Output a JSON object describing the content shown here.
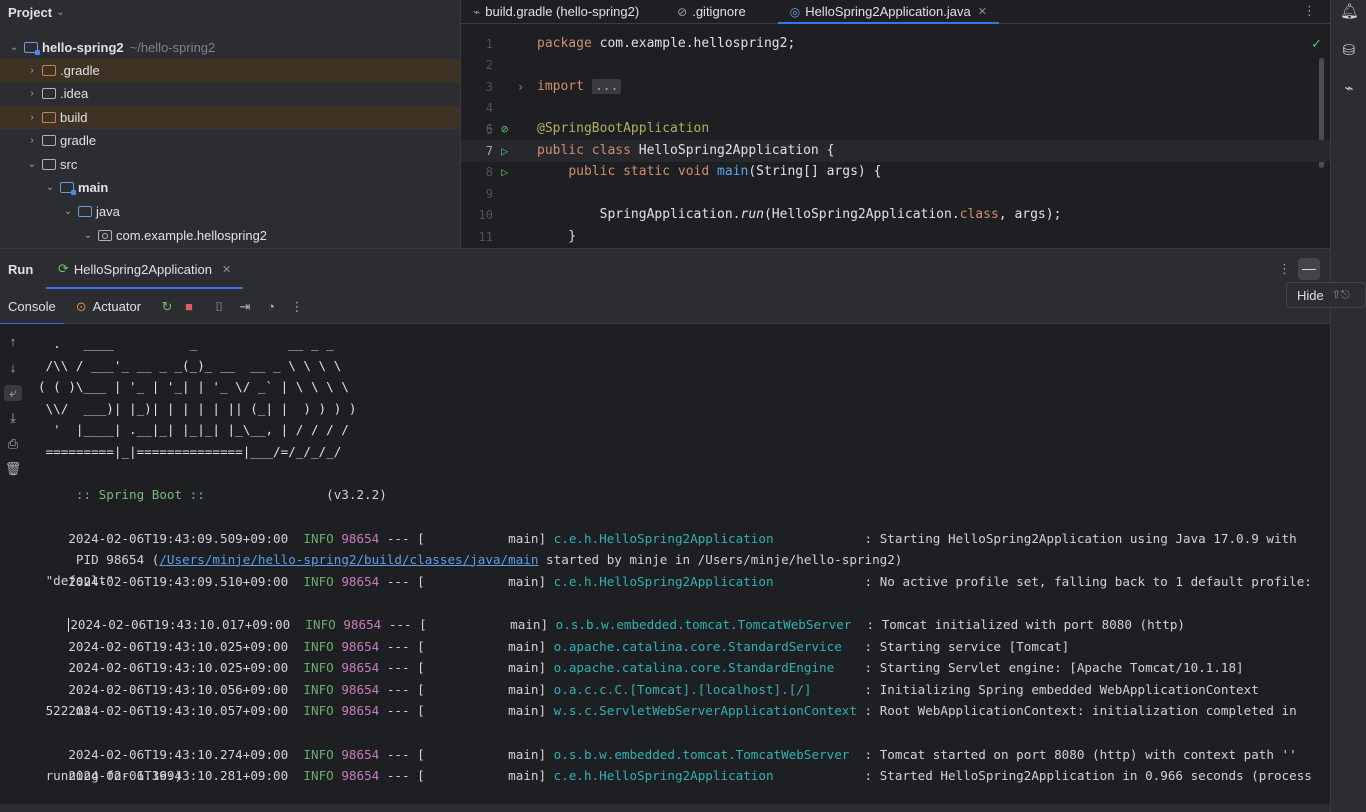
{
  "project": {
    "title": "Project",
    "tree": [
      {
        "name": "hello-spring2",
        "path": "~/hello-spring2",
        "level": 0,
        "expanded": true,
        "icon": "module-folder-icon",
        "bold": true
      },
      {
        "name": ".gradle",
        "level": 1,
        "expanded": false,
        "icon": "folder-icon",
        "excluded": true
      },
      {
        "name": ".idea",
        "level": 1,
        "expanded": false,
        "icon": "folder-icon"
      },
      {
        "name": "build",
        "level": 1,
        "expanded": false,
        "icon": "folder-icon",
        "excluded": true
      },
      {
        "name": "gradle",
        "level": 1,
        "expanded": false,
        "icon": "folder-icon"
      },
      {
        "name": "src",
        "level": 1,
        "expanded": true,
        "icon": "folder-icon"
      },
      {
        "name": "main",
        "level": 2,
        "expanded": true,
        "icon": "module-folder-icon",
        "bold": true
      },
      {
        "name": "java",
        "level": 3,
        "expanded": true,
        "icon": "source-folder-icon"
      },
      {
        "name": "com.example.hellospring2",
        "level": 4,
        "expanded": true,
        "icon": "package-icon"
      }
    ]
  },
  "editor": {
    "tabs": [
      {
        "label": "build.gradle (hello-spring2)",
        "icon": "gradle-icon",
        "active": false
      },
      {
        "label": ".gitignore",
        "icon": "ignore-file-icon",
        "active": false
      },
      {
        "label": "HelloSpring2Application.java",
        "icon": "spring-class-icon",
        "active": true
      }
    ],
    "line_numbers": [
      "1",
      "2",
      "3",
      "4",
      "5",
      "6",
      "7",
      "8",
      "9",
      "10",
      "11"
    ],
    "code": {
      "l1_kw": "package",
      "l1_rest": " com.example.hellospring2;",
      "l3_kw": "import",
      "l3_fold": "...",
      "l6_ann": "@SpringBootApplication",
      "l7_kw": "public class",
      "l7_rest": " HelloSpring2Application {",
      "l8_indent": "    ",
      "l8_kw": "public static void",
      "l8_fn": "main",
      "l8_rest": "(String[] args) {",
      "l10_a": "        SpringApplication.",
      "l10_it": "run",
      "l10_b": "(HelloSpring2Application.",
      "l10_kw": "class",
      "l10_c": ", args);",
      "l11": "    }"
    }
  },
  "run": {
    "title": "Run",
    "tab_label": "HelloSpring2Application",
    "hide_tooltip": "Hide",
    "hide_shortcut": "⇧⎋",
    "console_tab": "Console",
    "actuator_tab": "Actuator"
  },
  "console": {
    "banner": [
      "  .   ____          _            __ _ _",
      " /\\\\ / ___'_ __ _ _(_)_ __  __ _ \\ \\ \\ \\",
      "( ( )\\___ | '_ | '_| | '_ \\/ _` | \\ \\ \\ \\",
      " \\\\/  ___)| |_)| | | | | || (_| |  ) ) ) )",
      "  '  |____| .__|_| |_|_| |_\\__, | / / / /",
      " =========|_|==============|___/=/_/_/_/"
    ],
    "spring_label": " :: Spring Boot ::",
    "spring_version": "                (v3.2.2)",
    "logs": [
      {
        "ts": "2024-02-06T19:43:09.509+09:00",
        "level": "INFO",
        "pid": "98654",
        "thread": " --- [           main] ",
        "logger": "c.e.h.HelloSpring2Application           ",
        "msg": " : Starting HelloSpring2Application using Java 17.0.9 with"
      },
      {
        "ts": "2024-02-06T19:43:09.510+09:00",
        "level": "INFO",
        "pid": "98654",
        "thread": " --- [           main] ",
        "logger": "c.e.h.HelloSpring2Application           ",
        "msg": " : No active profile set, falling back to 1 default profile:"
      },
      {
        "ts": "2024-02-06T19:43:10.017+09:00",
        "level": "INFO",
        "pid": "98654",
        "thread": " --- [           main] ",
        "logger": "o.s.b.w.embedded.tomcat.TomcatWebServer ",
        "msg": " : Tomcat initialized with port 8080 (http)"
      },
      {
        "ts": "2024-02-06T19:43:10.025+09:00",
        "level": "INFO",
        "pid": "98654",
        "thread": " --- [           main] ",
        "logger": "o.apache.catalina.core.StandardService  ",
        "msg": " : Starting service [Tomcat]"
      },
      {
        "ts": "2024-02-06T19:43:10.025+09:00",
        "level": "INFO",
        "pid": "98654",
        "thread": " --- [           main] ",
        "logger": "o.apache.catalina.core.StandardEngine   ",
        "msg": " : Starting Servlet engine: [Apache Tomcat/10.1.18]"
      },
      {
        "ts": "2024-02-06T19:43:10.056+09:00",
        "level": "INFO",
        "pid": "98654",
        "thread": " --- [           main] ",
        "logger": "o.a.c.c.C.[Tomcat].[localhost].[/]      ",
        "msg": " : Initializing Spring embedded WebApplicationContext"
      },
      {
        "ts": "2024-02-06T19:43:10.057+09:00",
        "level": "INFO",
        "pid": "98654",
        "thread": " --- [           main] ",
        "logger": "w.s.c.ServletWebServerApplicationContext",
        "msg": " : Root WebApplicationContext: initialization completed in"
      },
      {
        "ts": "2024-02-06T19:43:10.274+09:00",
        "level": "INFO",
        "pid": "98654",
        "thread": " --- [           main] ",
        "logger": "o.s.b.w.embedded.tomcat.TomcatWebServer ",
        "msg": " : Tomcat started on port 8080 (http) with context path ''"
      },
      {
        "ts": "2024-02-06T19:43:10.281+09:00",
        "level": "INFO",
        "pid": "98654",
        "thread": " --- [           main] ",
        "logger": "c.e.h.HelloSpring2Application           ",
        "msg": " : Started HelloSpring2Application in 0.966 seconds (process"
      }
    ],
    "cont1_a": " PID 98654 (",
    "cont1_link": "/Users/minje/hello-spring2/build/classes/java/main",
    "cont1_b": " started by minje in /Users/minje/hello-spring2)",
    "cont2": " \"default\"",
    "cont3": " 522 ms",
    "cont4": " running for 1.369)"
  },
  "colors": {
    "accent": "#3574f0",
    "info": "#6aab73",
    "pid": "#c77dbb",
    "logger": "#2fb2b2",
    "link": "#5c9ee8"
  }
}
